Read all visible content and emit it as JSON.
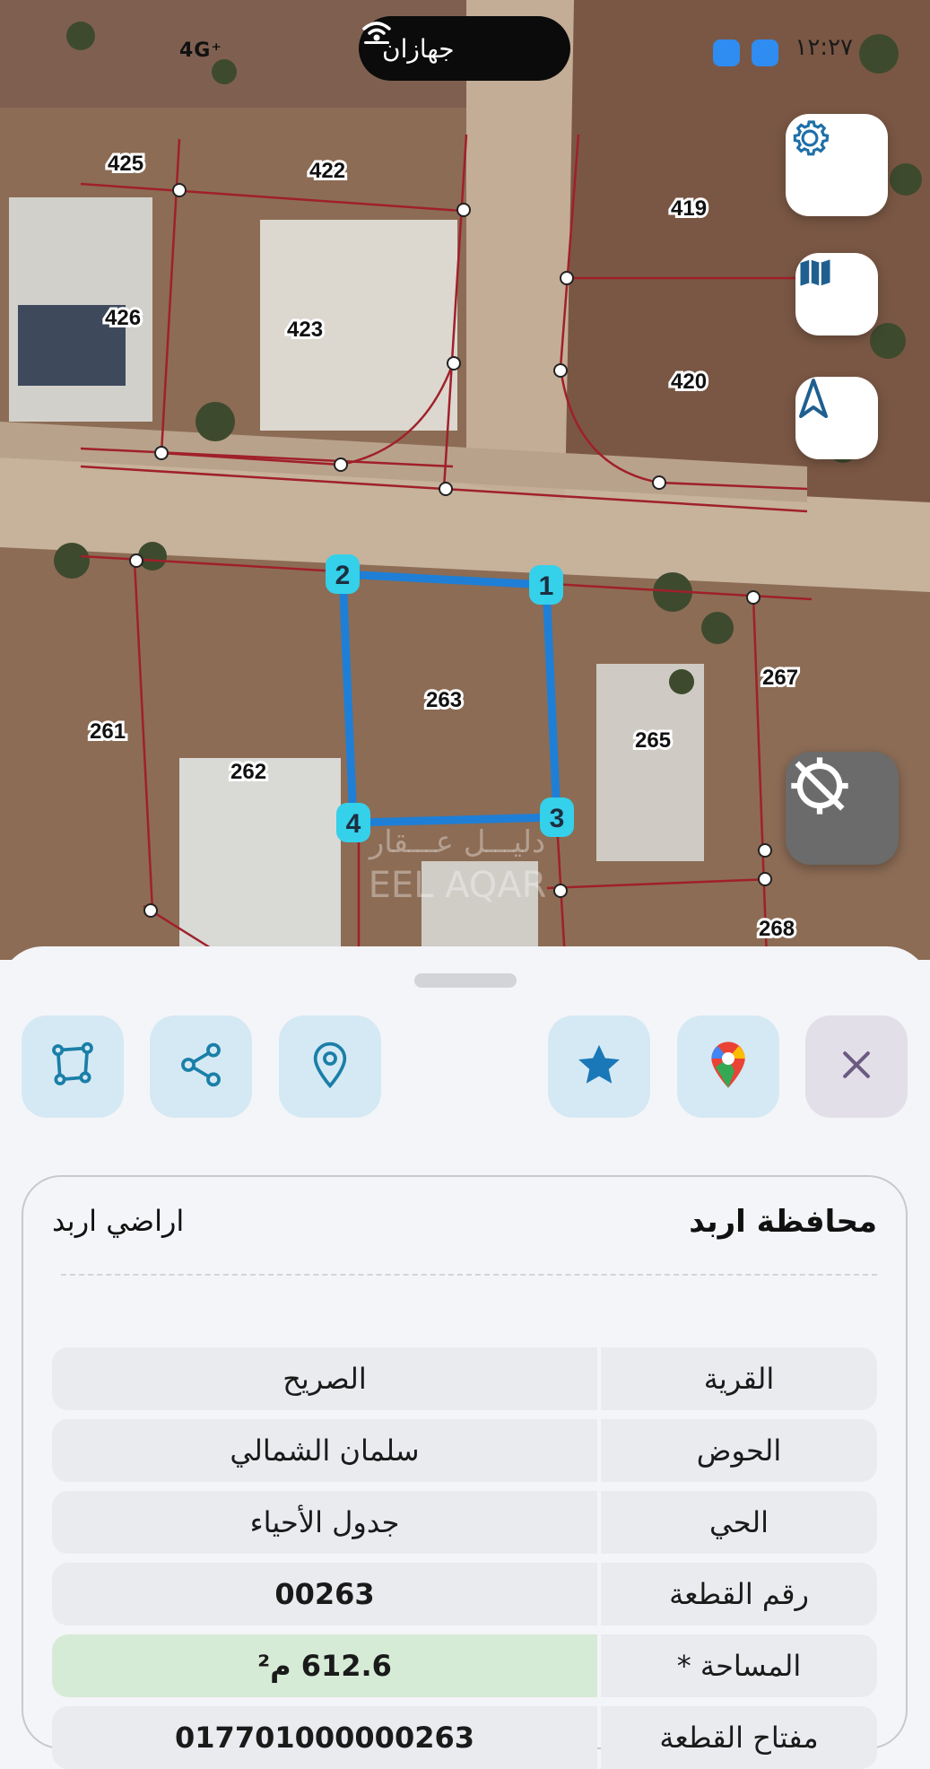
{
  "status_bar": {
    "time": "١٢:٢٧",
    "network": "4G⁺",
    "island_label": "جهازان"
  },
  "map": {
    "parcels": [
      "425",
      "422",
      "419",
      "426",
      "423",
      "420",
      "263",
      "267",
      "261",
      "262",
      "265",
      "268"
    ],
    "vertices": [
      "1",
      "2",
      "3",
      "4"
    ],
    "watermark": "دليـــل عـــقار",
    "watermark_latin": "EEL AQAR"
  },
  "icons": {
    "settings": "gear-icon",
    "layers": "map-icon",
    "north": "navigation-arrow-icon",
    "gps": "gps-off-icon",
    "polygon": "polygon-icon",
    "share": "share-icon",
    "location": "location-pin-icon",
    "favorite": "star-icon",
    "google_maps": "google-maps-icon",
    "close": "close-icon"
  },
  "card": {
    "governorate": "محافظة اربد",
    "directorate": "اراضي اربد",
    "rows": [
      {
        "label": "القرية",
        "value": "الصريح"
      },
      {
        "label": "الحوض",
        "value": "سلمان الشمالي"
      },
      {
        "label": "الحي",
        "value": "جدول الأحياء"
      },
      {
        "label": "رقم القطعة",
        "value": "00263"
      },
      {
        "label": "المساحة *",
        "value": "612.6 م²"
      },
      {
        "label": "مفتاح القطعة",
        "value": "017701000000263"
      }
    ]
  },
  "colors": {
    "parcel_outline": "#1f7fd6",
    "vertex_marker": "#35d0ea",
    "boundary_lines": "#a0202a",
    "area_highlight": "#d6ebd6"
  }
}
